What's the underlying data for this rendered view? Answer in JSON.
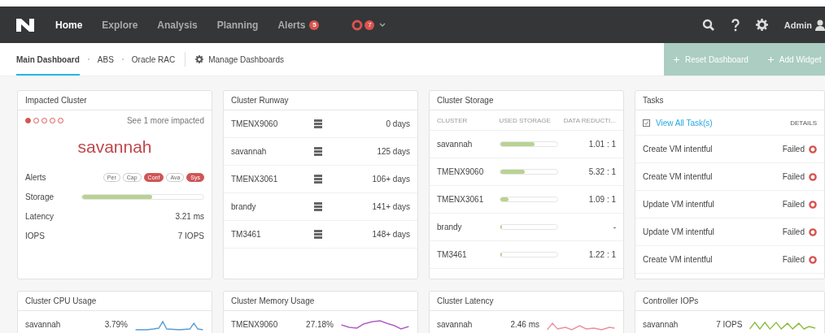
{
  "topbar": {
    "nav": [
      {
        "label": "Home",
        "selected": true
      },
      {
        "label": "Explore",
        "selected": false
      },
      {
        "label": "Analysis",
        "selected": false
      },
      {
        "label": "Planning",
        "selected": false
      },
      {
        "label": "Alerts",
        "selected": false,
        "badge": "5"
      }
    ],
    "alert_count": "7",
    "user": "Admin"
  },
  "subnav": {
    "tabs": [
      {
        "label": "Main Dashboard",
        "selected": true
      },
      {
        "label": "ABS",
        "selected": false
      },
      {
        "label": "Oracle RAC",
        "selected": false
      }
    ],
    "manage": "Manage Dashboards",
    "actions": [
      "Reset Dashboard",
      "Add Widget"
    ]
  },
  "impacted": {
    "title": "Impacted Cluster",
    "dots": [
      {
        "selected": true
      },
      {
        "selected": false
      },
      {
        "selected": false
      },
      {
        "selected": false
      },
      {
        "selected": false
      }
    ],
    "see_more": "See 1 more impacted",
    "cluster": "savannah",
    "alerts_label": "Alerts",
    "alert_tags": [
      {
        "label": "Per",
        "active": false
      },
      {
        "label": "Cap",
        "active": false
      },
      {
        "label": "Conf",
        "active": true
      },
      {
        "label": "Ava",
        "active": false
      },
      {
        "label": "Sys",
        "active": true
      }
    ],
    "storage_bar": {
      "label": "Storage",
      "level": 0.58
    },
    "metrics": [
      {
        "label": "Latency",
        "value": "3.21 ms"
      },
      {
        "label": "IOPS",
        "value": "7 IOPS"
      }
    ]
  },
  "runway": {
    "title": "Cluster Runway",
    "rows": [
      {
        "name": "TMENX9060",
        "days": "0 days"
      },
      {
        "name": "savannah",
        "days": "125 days"
      },
      {
        "name": "TMENX3061",
        "days": "106+ days"
      },
      {
        "name": "brandy",
        "days": "141+ days"
      },
      {
        "name": "TM3461",
        "days": "148+ days"
      }
    ]
  },
  "storage": {
    "title": "Cluster Storage",
    "columns": [
      "CLUSTER",
      "USED STORAGE",
      "DATA REDUCTI..."
    ],
    "rows": [
      {
        "name": "savannah",
        "level": 0.6,
        "ratio": "1.01 : 1"
      },
      {
        "name": "TMENX9060",
        "level": 0.43,
        "ratio": "5.32 : 1"
      },
      {
        "name": "TMENX3061",
        "level": 0.14,
        "ratio": "1.09 : 1"
      },
      {
        "name": "brandy",
        "level": 0.03,
        "ratio": "-"
      },
      {
        "name": "TM3461",
        "level": 0.03,
        "ratio": "1.22 : 1"
      }
    ]
  },
  "tasks": {
    "title": "Tasks",
    "view_all": "View All Task(s)",
    "details": "DETAILS",
    "rows": [
      {
        "name": "Create VM intentful",
        "status": "Failed"
      },
      {
        "name": "Create VM intentful",
        "status": "Failed"
      },
      {
        "name": "Update VM intentful",
        "status": "Failed"
      },
      {
        "name": "Update VM intentful",
        "status": "Failed"
      },
      {
        "name": "Create VM intentful",
        "status": "Failed"
      }
    ]
  },
  "usage_cards": [
    {
      "title": "Cluster CPU Usage",
      "name": "savannah",
      "value": "3.79%",
      "color": "#5b9bd5"
    },
    {
      "title": "Cluster Memory Usage",
      "name": "TMENX9060",
      "value": "27.18%",
      "color": "#b05cc9"
    },
    {
      "title": "Cluster Latency",
      "name": "savannah",
      "value": "2.46 ms",
      "color": "#e8909a"
    },
    {
      "title": "Controller IOPs",
      "name": "savannah",
      "value": "7 IOPS",
      "color": "#8bbb3c"
    }
  ]
}
